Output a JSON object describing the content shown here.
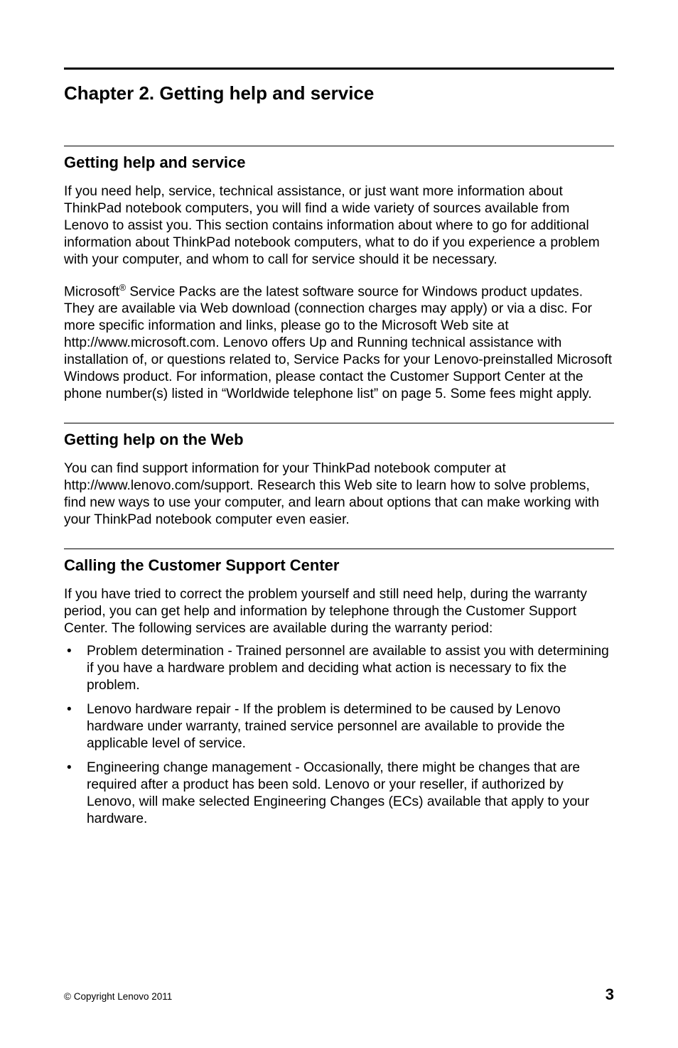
{
  "chapter_title": "Chapter 2.  Getting help and service",
  "sections": {
    "s1": {
      "heading": "Getting help and service",
      "p1": "If you need help, service, technical assistance, or just want more information about ThinkPad notebook computers, you will find a wide variety of sources available from Lenovo to assist you.  This section contains information about where to go for additional information about ThinkPad notebook computers, what to do if you experience a problem with your computer, and whom to call for service should it be necessary.",
      "p2_pre": "Microsoft",
      "p2_sup": "®",
      "p2_post": " Service Packs are the latest software source for Windows product updates.  They are available via Web download (connection charges may apply) or via a disc.  For more specific information and links, please go to the Microsoft Web site at http://www.microsoft.com.  Lenovo offers Up and Running technical assistance with installation of, or questions related to, Service Packs for your Lenovo-preinstalled Microsoft Windows product.  For information, please contact the Customer Support Center at the phone number(s) listed in “Worldwide telephone list” on page 5.  Some fees might apply."
    },
    "s2": {
      "heading": "Getting help on the Web",
      "p1": "You can find support information for your ThinkPad notebook computer at http://www.lenovo.com/support.  Research this Web site to learn how to solve problems, find new ways to use your computer, and learn about options that can make working with your ThinkPad notebook computer even easier."
    },
    "s3": {
      "heading": "Calling the Customer Support Center",
      "p1": "If you have tried to correct the problem yourself and still need help, during the warranty period, you can get help and information by telephone through the Customer Support Center.  The following services are available during the warranty period:",
      "b1": "Problem determination - Trained personnel are available to assist you with determining if you have a hardware problem and deciding what action is necessary to fix the problem.",
      "b2": "Lenovo hardware repair - If the problem is determined to be caused by Lenovo hardware under warranty, trained service personnel are available to provide the applicable level of service.",
      "b3": "Engineering change management - Occasionally, there might be changes that are required after a product has been sold.  Lenovo or your reseller, if authorized by Lenovo, will make selected Engineering Changes (ECs) available that apply to your hardware."
    }
  },
  "footer": {
    "copyright": "© Copyright Lenovo 2011",
    "page_number": "3"
  }
}
